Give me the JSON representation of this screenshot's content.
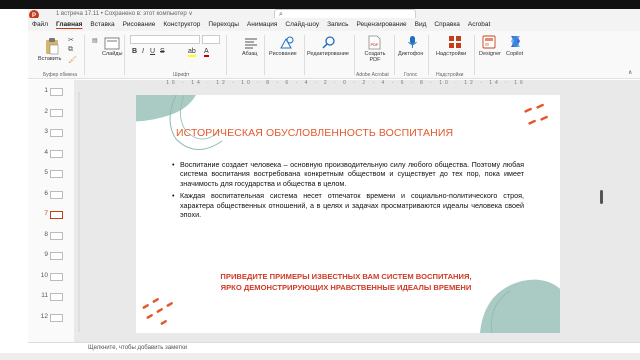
{
  "window": {
    "meta_text": "1 встреча 17.11 • Сохранено в: этот компьютер ∨",
    "search_placeholder": "",
    "search_icon": "search-icon"
  },
  "tabs": [
    "Файл",
    "Главная",
    "Вставка",
    "Рисование",
    "Конструктор",
    "Переходы",
    "Анимация",
    "Слайд-шоу",
    "Запись",
    "Рецензирование",
    "Вид",
    "Справка",
    "Acrobat"
  ],
  "active_tab": "Главная",
  "ribbon": {
    "paste": "Вставить",
    "clipboard_group": "Буфер обмена",
    "slides": "Слайды",
    "font_group": "Шрифт",
    "paragraph": "Абзац",
    "drawing": "Рисование",
    "editing": "Редактирование",
    "create_pdf": "Создать PDF",
    "adobe_group": "Adobe Acrobat",
    "dictation": "Диктофон",
    "voice_group": "Голос",
    "addins": "Надстройки",
    "addins_group": "Надстройки",
    "designer": "Designer",
    "copilot": "Copilot"
  },
  "ruler_top": "16 · 14 · 12 · 10 · 8 · 6 · 4 · 2 · 0 · 2 · 4 · 6 · 8 · 10 · 12 · 14 · 16",
  "thumbnails": [
    "1",
    "2",
    "3",
    "4",
    "5",
    "6",
    "7",
    "8",
    "9",
    "10",
    "11",
    "12"
  ],
  "selected_slide": "7",
  "slide": {
    "title": "ИСТОРИЧЕСКАЯ ОБУСЛОВЛЕННОСТЬ ВОСПИТАНИЯ",
    "bullet1": "Воспитание создает человека – основную производительную силу любого общества. Поэтому любая система воспитания востребована конкретным обществом и существует до тех пор, пока имеет значимость для государства и общества в целом.",
    "bullet2": "Каждая воспитательная система несет отпечаток времени и социально-политического строя, характера общественных отношений, а в целях и задачах просматриваются идеалы человека своей эпохи.",
    "footer_line1": "ПРИВЕДИТЕ ПРИМЕРЫ ИЗВЕСТНЫХ ВАМ СИСТЕМ ВОСПИТАНИЯ,",
    "footer_line2": "ЯРКО ДЕМОНСТРИРУЮЩИХ НРАВСТВЕННЫЕ ИДЕАЛЫ ВРЕМЕНИ"
  },
  "notes": "Щелкните, чтобы добавить заметки",
  "colors": {
    "accent": "#c43e1c",
    "title": "#e3582d",
    "teal": "#9cc2b9",
    "footer": "#d03a25"
  }
}
